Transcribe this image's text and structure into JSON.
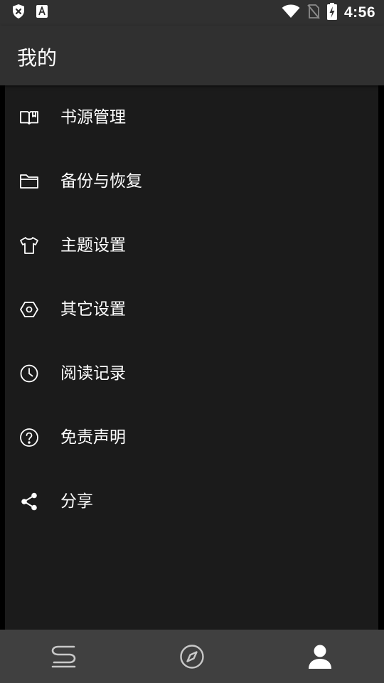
{
  "status_bar": {
    "time": "4:56",
    "left_icons": [
      "shield-x-icon",
      "font-a-icon"
    ],
    "right_icons": [
      "wifi-icon",
      "no-sim-icon",
      "battery-charging-icon"
    ]
  },
  "app_bar": {
    "title": "我的"
  },
  "menu": {
    "items": [
      {
        "label": "书源管理",
        "icon": "book-open-icon"
      },
      {
        "label": "备份与恢复",
        "icon": "folder-icon"
      },
      {
        "label": "主题设置",
        "icon": "tshirt-icon"
      },
      {
        "label": "其它设置",
        "icon": "hexagon-settings-icon"
      },
      {
        "label": "阅读记录",
        "icon": "clock-icon"
      },
      {
        "label": "免责声明",
        "icon": "help-circle-icon"
      },
      {
        "label": "分享",
        "icon": "share-icon"
      }
    ]
  },
  "bottom_nav": {
    "items": [
      {
        "name": "bookshelf",
        "icon": "bookshelf-icon",
        "active": false
      },
      {
        "name": "discover",
        "icon": "compass-icon",
        "active": false
      },
      {
        "name": "mine",
        "icon": "person-icon",
        "active": true
      }
    ]
  },
  "colors": {
    "status_bar_bg": "#303030",
    "app_bar_bg": "#303030",
    "list_bg": "#1b1b1b",
    "side_gutter": "#000000",
    "bottom_nav_bg": "#404040",
    "text_primary": "#ffffff",
    "nav_icon_inactive": "#c8c8c8",
    "nav_icon_active": "#ffffff"
  }
}
